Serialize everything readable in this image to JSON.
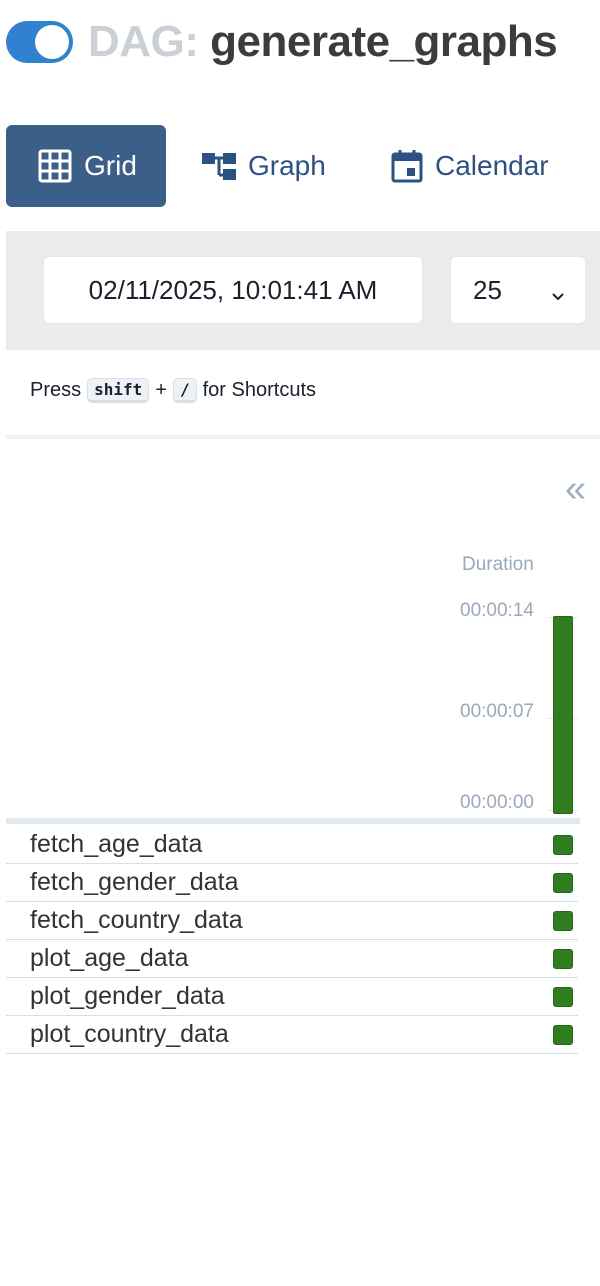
{
  "header": {
    "toggle_state": "on",
    "title_prefix": "DAG: ",
    "dag_id": "generate_graphs"
  },
  "tabs": [
    {
      "label": "Grid",
      "icon": "grid-icon",
      "active": true
    },
    {
      "label": "Graph",
      "icon": "graph-icon",
      "active": false
    },
    {
      "label": "Calendar",
      "icon": "calendar-icon",
      "active": false
    }
  ],
  "filters": {
    "base_date": "02/11/2025, 10:01:41 AM",
    "num_runs": "25"
  },
  "shortcut_hint": {
    "prefix": "Press",
    "key1": "shift",
    "plus": "+",
    "key2": "/",
    "suffix": "for Shortcuts"
  },
  "collapse_icon": "double-chevron-left-icon",
  "duration_chart": {
    "label": "Duration",
    "ticks": [
      "00:00:14",
      "00:00:07",
      "00:00:00"
    ],
    "run_duration_seconds": 14,
    "max_seconds": 14,
    "bar_color": "#2f7d1e"
  },
  "tasks": [
    {
      "name": "fetch_age_data",
      "status": "success"
    },
    {
      "name": "fetch_gender_data",
      "status": "success"
    },
    {
      "name": "fetch_country_data",
      "status": "success"
    },
    {
      "name": "plot_age_data",
      "status": "success"
    },
    {
      "name": "plot_gender_data",
      "status": "success"
    },
    {
      "name": "plot_country_data",
      "status": "success"
    }
  ],
  "colors": {
    "accent": "#3182ce",
    "active_tab": "#3c5f8a",
    "success": "#2f7d1e"
  }
}
